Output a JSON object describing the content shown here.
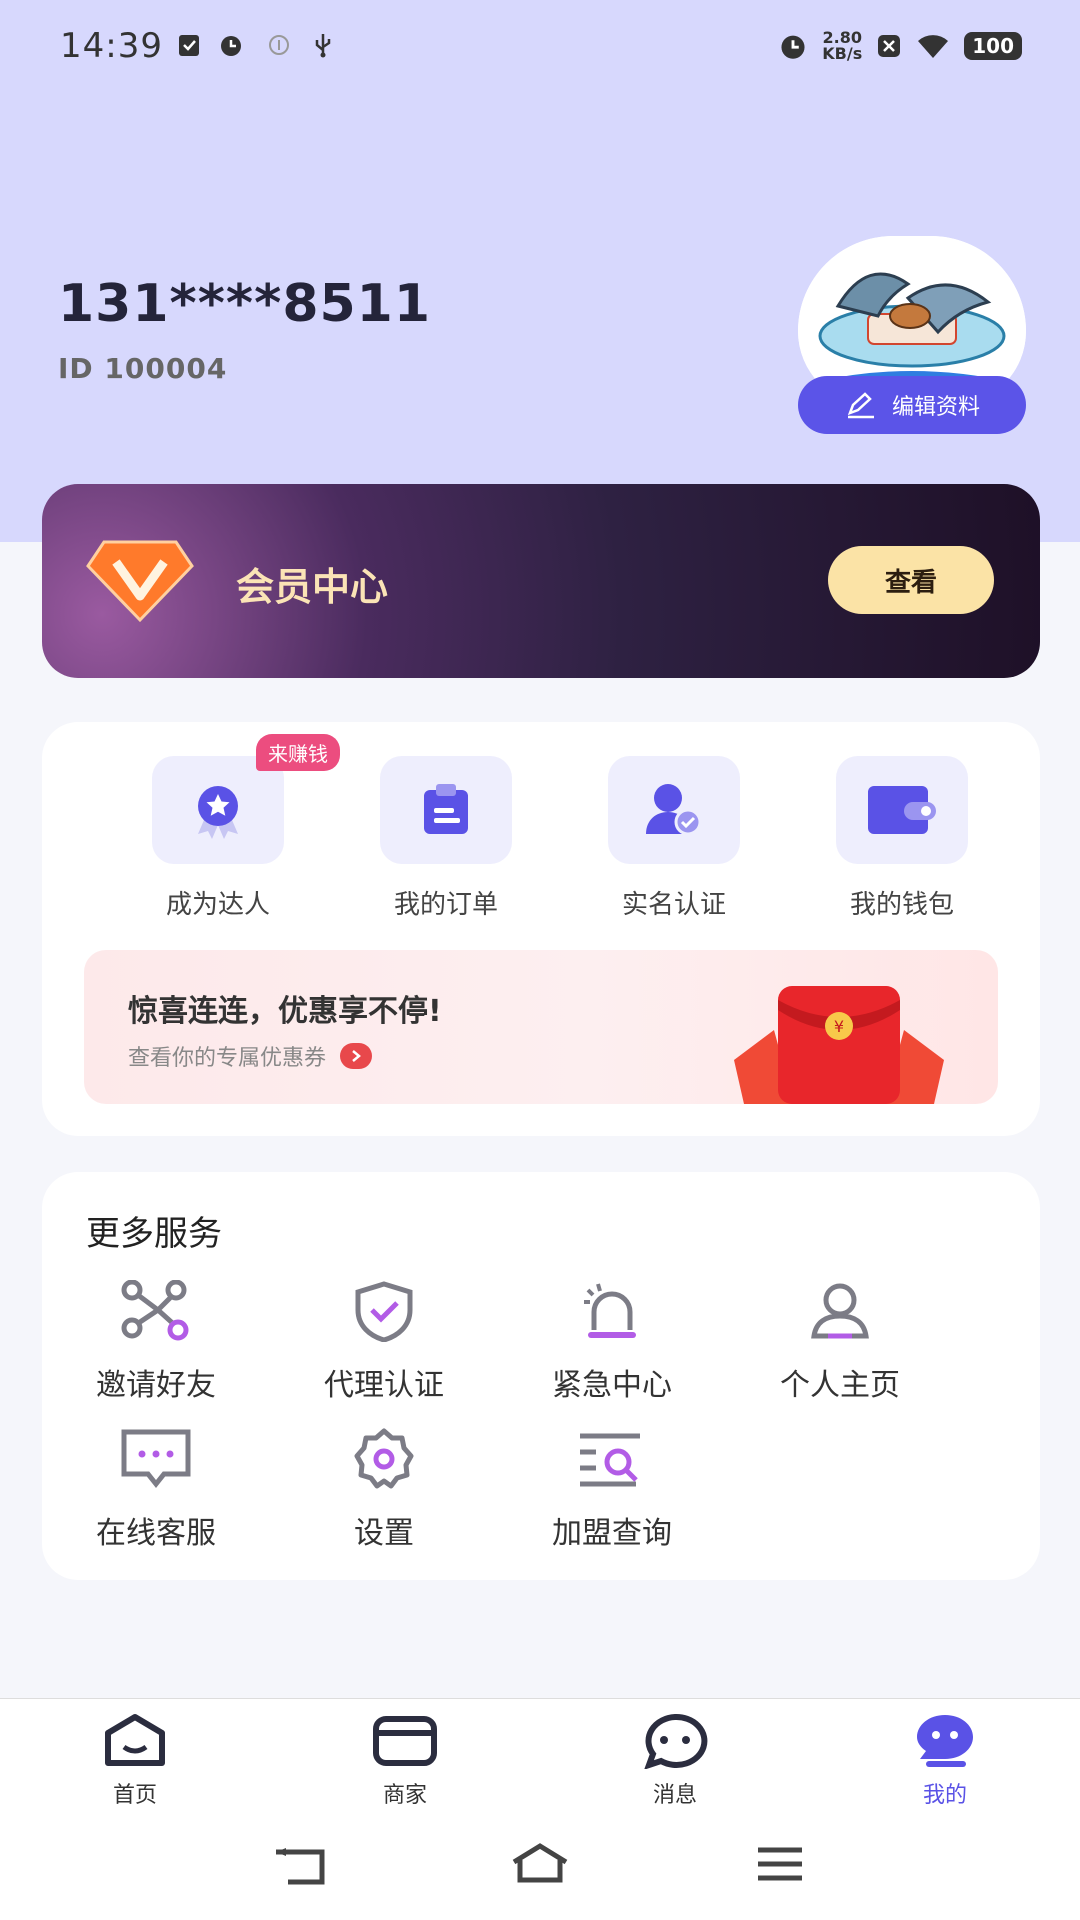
{
  "status_bar": {
    "time": "14:39",
    "net_speed_value": "2.80",
    "net_speed_unit": "KB/s",
    "battery": "100"
  },
  "profile": {
    "phone": "131****8511",
    "user_id": "ID 100004",
    "edit_label": "编辑资料"
  },
  "vip": {
    "title": "会员中心",
    "button": "查看"
  },
  "quick_actions": {
    "items": [
      {
        "label": "成为达人",
        "icon": "badge-star-icon"
      },
      {
        "label": "我的订单",
        "icon": "clipboard-icon"
      },
      {
        "label": "实名认证",
        "icon": "user-verified-icon"
      },
      {
        "label": "我的钱包",
        "icon": "wallet-icon"
      }
    ],
    "earn_badge": "来赚钱"
  },
  "promo": {
    "title": "惊喜连连，优惠享不停!",
    "subtitle": "查看你的专属优惠券"
  },
  "services": {
    "title": "更多服务",
    "items": [
      {
        "label": "邀请好友",
        "icon": "share-nodes-icon"
      },
      {
        "label": "代理认证",
        "icon": "shield-check-icon"
      },
      {
        "label": "紧急中心",
        "icon": "alarm-light-icon"
      },
      {
        "label": "个人主页",
        "icon": "person-icon"
      },
      {
        "label": "在线客服",
        "icon": "chat-box-icon"
      },
      {
        "label": "设置",
        "icon": "gear-icon"
      },
      {
        "label": "加盟查询",
        "icon": "list-search-icon"
      }
    ]
  },
  "tabbar": {
    "items": [
      {
        "label": "首页",
        "icon": "home-icon"
      },
      {
        "label": "商家",
        "icon": "store-icon"
      },
      {
        "label": "消息",
        "icon": "message-icon"
      },
      {
        "label": "我的",
        "icon": "me-icon"
      }
    ],
    "active_index": 3
  },
  "colors": {
    "accent": "#5a52e6",
    "hero_bg": "#d7d8fd",
    "vip_gold": "#fbe3a6",
    "badge_pink": "#ec4d7f"
  }
}
